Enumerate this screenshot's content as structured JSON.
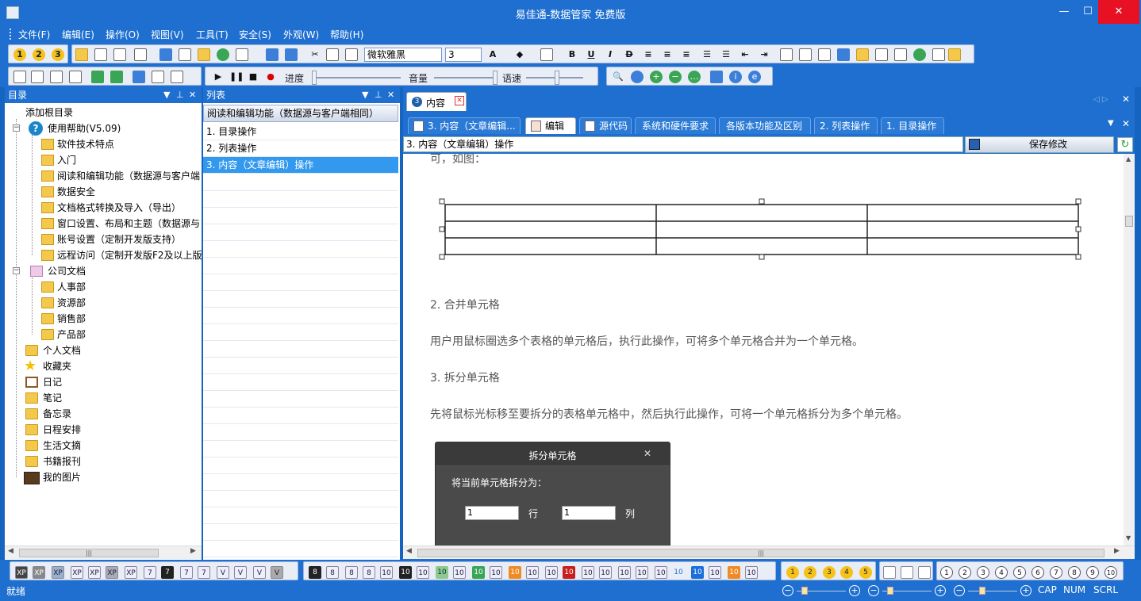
{
  "window": {
    "title": "易佳通-数据管家 免费版",
    "min": "—",
    "max": "☐",
    "close": "✕"
  },
  "menu": [
    "文件(F)",
    "编辑(E)",
    "操作(O)",
    "视图(V)",
    "工具(T)",
    "安全(S)",
    "外观(W)",
    "帮助(H)"
  ],
  "toolbar": {
    "font_name": "微软雅黑",
    "font_size": "3",
    "progress_label": "进度",
    "volume_label": "音量",
    "speed_label": "语速",
    "circle_buttons": [
      "1",
      "2",
      "3"
    ]
  },
  "tree_pane": {
    "title": "目录",
    "items": [
      {
        "label": "添加根目录"
      },
      {
        "label": "使用帮助(V5.09)"
      },
      {
        "label": "软件技术特点"
      },
      {
        "label": "入门"
      },
      {
        "label": "阅读和编辑功能（数据源与客户端"
      },
      {
        "label": "数据安全"
      },
      {
        "label": "文档格式转换及导入（导出）"
      },
      {
        "label": "窗口设置、布局和主题（数据源与"
      },
      {
        "label": "账号设置（定制开发版支持）"
      },
      {
        "label": "远程访问（定制开发版F2及以上版"
      },
      {
        "label": "公司文档"
      },
      {
        "label": "人事部"
      },
      {
        "label": "资源部"
      },
      {
        "label": "销售部"
      },
      {
        "label": "产品部"
      },
      {
        "label": "个人文档"
      },
      {
        "label": "收藏夹"
      },
      {
        "label": "日记"
      },
      {
        "label": "笔记"
      },
      {
        "label": "备忘录"
      },
      {
        "label": "日程安排"
      },
      {
        "label": "生活文摘"
      },
      {
        "label": "书籍报刊"
      },
      {
        "label": "我的图片"
      }
    ]
  },
  "list_pane": {
    "title": "列表",
    "header": "阅读和编辑功能（数据源与客户端相同）",
    "items": [
      "1. 目录操作",
      "2. 列表操作",
      "3. 内容（文章编辑）操作"
    ],
    "selected_index": 2
  },
  "content_pane": {
    "doc_tab": "内容",
    "doc_tab_number": "3",
    "tabs": [
      "3. 内容（文章编辑...",
      "编辑",
      "源代码",
      "系统和硬件要求",
      "各版本功能及区别",
      "2. 列表操作",
      "1. 目录操作"
    ],
    "active_tab_index": 1,
    "title_field": "3. 内容（文章编辑）操作",
    "save_button": "保存修改",
    "paragraphs": {
      "top_fragment": "可，如图：",
      "merge_heading": "2. 合并单元格",
      "merge_text": "用户用鼠标圈选多个表格的单元格后，执行此操作，可将多个单元格合并为一个单元格。",
      "split_heading": "3. 拆分单元格",
      "split_text": "先将鼠标光标移至要拆分的表格单元格中，然后执行此操作，可将一个单元格拆分为多个单元格。"
    },
    "dialog": {
      "title": "拆分单元格",
      "prompt": "将当前单元格拆分为：",
      "rows_value": "1",
      "rows_label": "行",
      "cols_value": "1",
      "cols_label": "列"
    }
  },
  "bottom_toolbar": {
    "format_buttons": [
      "XP",
      "XP",
      "XP",
      "XP",
      "XP",
      "XP",
      "XP",
      "7",
      "7",
      "7",
      "7",
      "V",
      "V",
      "V",
      "V"
    ],
    "style_buttons": [
      "8",
      "8",
      "8",
      "8",
      "10",
      "10",
      "10",
      "10",
      "10",
      "10",
      "10",
      "10",
      "10",
      "10",
      "10",
      "10",
      "10",
      "10",
      "10",
      "10",
      "10",
      "10",
      "10",
      "10",
      "10",
      "10"
    ],
    "numbered_yellow": [
      "1",
      "2",
      "3",
      "4",
      "5"
    ],
    "numbered_white": [
      "1",
      "2",
      "3",
      "4",
      "5",
      "6",
      "7",
      "8",
      "9",
      "10"
    ]
  },
  "status": {
    "text": "就绪",
    "cap": "CAP",
    "num": "NUM",
    "scrl": "SCRL"
  },
  "colors": {
    "chrome": "#1e6fd0",
    "selection": "#3399ee",
    "close": "#e81123",
    "dialog": "#4a4a4a"
  }
}
